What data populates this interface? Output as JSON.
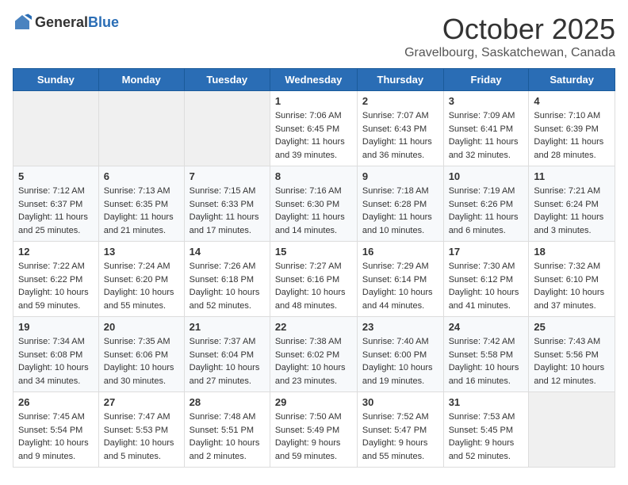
{
  "header": {
    "logo_general": "General",
    "logo_blue": "Blue",
    "month": "October 2025",
    "location": "Gravelbourg, Saskatchewan, Canada"
  },
  "weekdays": [
    "Sunday",
    "Monday",
    "Tuesday",
    "Wednesday",
    "Thursday",
    "Friday",
    "Saturday"
  ],
  "weeks": [
    [
      {
        "day": "",
        "sunrise": "",
        "sunset": "",
        "daylight": ""
      },
      {
        "day": "",
        "sunrise": "",
        "sunset": "",
        "daylight": ""
      },
      {
        "day": "",
        "sunrise": "",
        "sunset": "",
        "daylight": ""
      },
      {
        "day": "1",
        "sunrise": "Sunrise: 7:06 AM",
        "sunset": "Sunset: 6:45 PM",
        "daylight": "Daylight: 11 hours and 39 minutes."
      },
      {
        "day": "2",
        "sunrise": "Sunrise: 7:07 AM",
        "sunset": "Sunset: 6:43 PM",
        "daylight": "Daylight: 11 hours and 36 minutes."
      },
      {
        "day": "3",
        "sunrise": "Sunrise: 7:09 AM",
        "sunset": "Sunset: 6:41 PM",
        "daylight": "Daylight: 11 hours and 32 minutes."
      },
      {
        "day": "4",
        "sunrise": "Sunrise: 7:10 AM",
        "sunset": "Sunset: 6:39 PM",
        "daylight": "Daylight: 11 hours and 28 minutes."
      }
    ],
    [
      {
        "day": "5",
        "sunrise": "Sunrise: 7:12 AM",
        "sunset": "Sunset: 6:37 PM",
        "daylight": "Daylight: 11 hours and 25 minutes."
      },
      {
        "day": "6",
        "sunrise": "Sunrise: 7:13 AM",
        "sunset": "Sunset: 6:35 PM",
        "daylight": "Daylight: 11 hours and 21 minutes."
      },
      {
        "day": "7",
        "sunrise": "Sunrise: 7:15 AM",
        "sunset": "Sunset: 6:33 PM",
        "daylight": "Daylight: 11 hours and 17 minutes."
      },
      {
        "day": "8",
        "sunrise": "Sunrise: 7:16 AM",
        "sunset": "Sunset: 6:30 PM",
        "daylight": "Daylight: 11 hours and 14 minutes."
      },
      {
        "day": "9",
        "sunrise": "Sunrise: 7:18 AM",
        "sunset": "Sunset: 6:28 PM",
        "daylight": "Daylight: 11 hours and 10 minutes."
      },
      {
        "day": "10",
        "sunrise": "Sunrise: 7:19 AM",
        "sunset": "Sunset: 6:26 PM",
        "daylight": "Daylight: 11 hours and 6 minutes."
      },
      {
        "day": "11",
        "sunrise": "Sunrise: 7:21 AM",
        "sunset": "Sunset: 6:24 PM",
        "daylight": "Daylight: 11 hours and 3 minutes."
      }
    ],
    [
      {
        "day": "12",
        "sunrise": "Sunrise: 7:22 AM",
        "sunset": "Sunset: 6:22 PM",
        "daylight": "Daylight: 10 hours and 59 minutes."
      },
      {
        "day": "13",
        "sunrise": "Sunrise: 7:24 AM",
        "sunset": "Sunset: 6:20 PM",
        "daylight": "Daylight: 10 hours and 55 minutes."
      },
      {
        "day": "14",
        "sunrise": "Sunrise: 7:26 AM",
        "sunset": "Sunset: 6:18 PM",
        "daylight": "Daylight: 10 hours and 52 minutes."
      },
      {
        "day": "15",
        "sunrise": "Sunrise: 7:27 AM",
        "sunset": "Sunset: 6:16 PM",
        "daylight": "Daylight: 10 hours and 48 minutes."
      },
      {
        "day": "16",
        "sunrise": "Sunrise: 7:29 AM",
        "sunset": "Sunset: 6:14 PM",
        "daylight": "Daylight: 10 hours and 44 minutes."
      },
      {
        "day": "17",
        "sunrise": "Sunrise: 7:30 AM",
        "sunset": "Sunset: 6:12 PM",
        "daylight": "Daylight: 10 hours and 41 minutes."
      },
      {
        "day": "18",
        "sunrise": "Sunrise: 7:32 AM",
        "sunset": "Sunset: 6:10 PM",
        "daylight": "Daylight: 10 hours and 37 minutes."
      }
    ],
    [
      {
        "day": "19",
        "sunrise": "Sunrise: 7:34 AM",
        "sunset": "Sunset: 6:08 PM",
        "daylight": "Daylight: 10 hours and 34 minutes."
      },
      {
        "day": "20",
        "sunrise": "Sunrise: 7:35 AM",
        "sunset": "Sunset: 6:06 PM",
        "daylight": "Daylight: 10 hours and 30 minutes."
      },
      {
        "day": "21",
        "sunrise": "Sunrise: 7:37 AM",
        "sunset": "Sunset: 6:04 PM",
        "daylight": "Daylight: 10 hours and 27 minutes."
      },
      {
        "day": "22",
        "sunrise": "Sunrise: 7:38 AM",
        "sunset": "Sunset: 6:02 PM",
        "daylight": "Daylight: 10 hours and 23 minutes."
      },
      {
        "day": "23",
        "sunrise": "Sunrise: 7:40 AM",
        "sunset": "Sunset: 6:00 PM",
        "daylight": "Daylight: 10 hours and 19 minutes."
      },
      {
        "day": "24",
        "sunrise": "Sunrise: 7:42 AM",
        "sunset": "Sunset: 5:58 PM",
        "daylight": "Daylight: 10 hours and 16 minutes."
      },
      {
        "day": "25",
        "sunrise": "Sunrise: 7:43 AM",
        "sunset": "Sunset: 5:56 PM",
        "daylight": "Daylight: 10 hours and 12 minutes."
      }
    ],
    [
      {
        "day": "26",
        "sunrise": "Sunrise: 7:45 AM",
        "sunset": "Sunset: 5:54 PM",
        "daylight": "Daylight: 10 hours and 9 minutes."
      },
      {
        "day": "27",
        "sunrise": "Sunrise: 7:47 AM",
        "sunset": "Sunset: 5:53 PM",
        "daylight": "Daylight: 10 hours and 5 minutes."
      },
      {
        "day": "28",
        "sunrise": "Sunrise: 7:48 AM",
        "sunset": "Sunset: 5:51 PM",
        "daylight": "Daylight: 10 hours and 2 minutes."
      },
      {
        "day": "29",
        "sunrise": "Sunrise: 7:50 AM",
        "sunset": "Sunset: 5:49 PM",
        "daylight": "Daylight: 9 hours and 59 minutes."
      },
      {
        "day": "30",
        "sunrise": "Sunrise: 7:52 AM",
        "sunset": "Sunset: 5:47 PM",
        "daylight": "Daylight: 9 hours and 55 minutes."
      },
      {
        "day": "31",
        "sunrise": "Sunrise: 7:53 AM",
        "sunset": "Sunset: 5:45 PM",
        "daylight": "Daylight: 9 hours and 52 minutes."
      },
      {
        "day": "",
        "sunrise": "",
        "sunset": "",
        "daylight": ""
      }
    ]
  ]
}
